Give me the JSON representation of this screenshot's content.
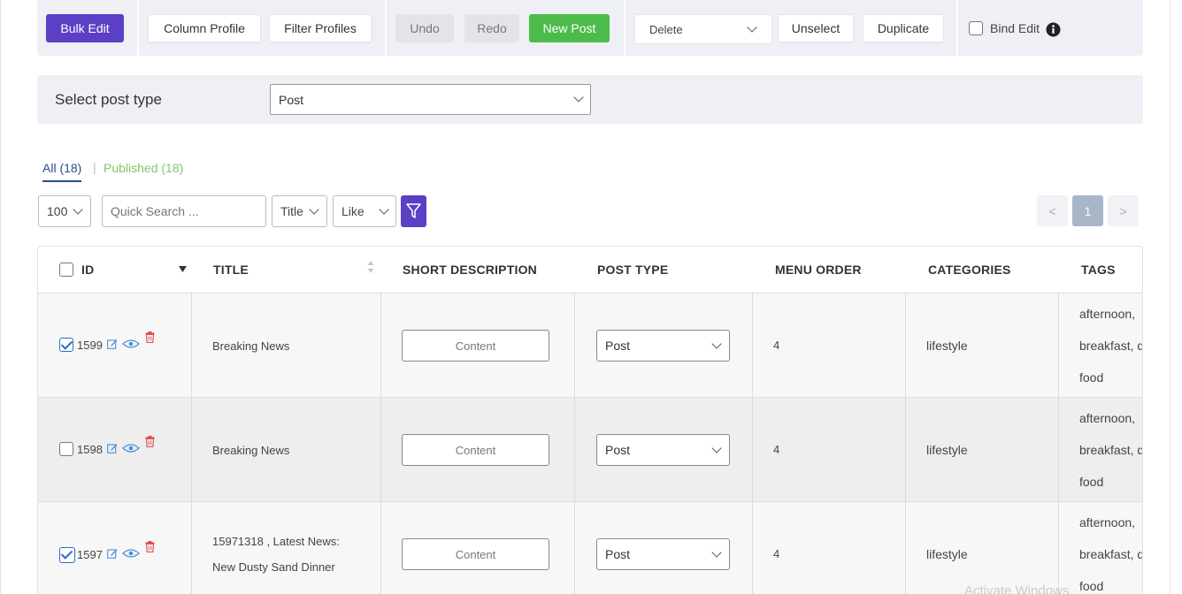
{
  "toolbar": {
    "bulk_edit": "Bulk Edit",
    "column_profile": "Column Profile",
    "filter_profiles": "Filter Profiles",
    "undo": "Undo",
    "redo": "Redo",
    "new_post": "New Post",
    "delete_select": "Delete",
    "unselect": "Unselect",
    "duplicate": "Duplicate",
    "bind_edit": "Bind Edit",
    "bind_edit_checked": false
  },
  "post_type_bar": {
    "label": "Select post type",
    "selected": "Post"
  },
  "tabs": [
    {
      "label": "All (18)",
      "active": true
    },
    {
      "label": "Published (18)",
      "active": false
    }
  ],
  "tab_separator": "|",
  "filters": {
    "per_page": "100",
    "search_placeholder": "Quick Search ...",
    "field": "Title",
    "operator": "Like"
  },
  "pagination": {
    "prev": "<",
    "current": "1",
    "next": ">"
  },
  "table": {
    "columns": [
      "ID",
      "TITLE",
      "SHORT DESCRIPTION",
      "POST TYPE",
      "MENU ORDER",
      "CATEGORIES",
      "TAGS"
    ],
    "rows": [
      {
        "checked": true,
        "id": "1599",
        "title_lines": [
          "Breaking News"
        ],
        "short_description": "Content",
        "post_type": "Post",
        "menu_order": "4",
        "categories": "lifestyle",
        "tags": [
          "afternoon,",
          "breakfast, d",
          "food"
        ]
      },
      {
        "checked": false,
        "id": "1598",
        "title_lines": [
          "Breaking News"
        ],
        "short_description": "Content",
        "post_type": "Post",
        "menu_order": "4",
        "categories": "lifestyle",
        "tags": [
          "afternoon,",
          "breakfast, d",
          "food"
        ]
      },
      {
        "checked": true,
        "id": "1597",
        "title_lines": [
          "15971318 , Latest News:",
          "New Dusty Sand Dinner"
        ],
        "short_description": "Content",
        "post_type": "Post",
        "menu_order": "4",
        "categories": "lifestyle",
        "tags": [
          "afternoon,",
          "breakfast, d",
          "food"
        ]
      }
    ]
  },
  "watermark": "Activate Windows",
  "colors": {
    "purple": "#5b3fc4",
    "green": "#4cbb4a",
    "toolbar_bg": "#eef0f6",
    "link_blue": "#2b6cc4",
    "tab_green": "#7cc86a"
  }
}
